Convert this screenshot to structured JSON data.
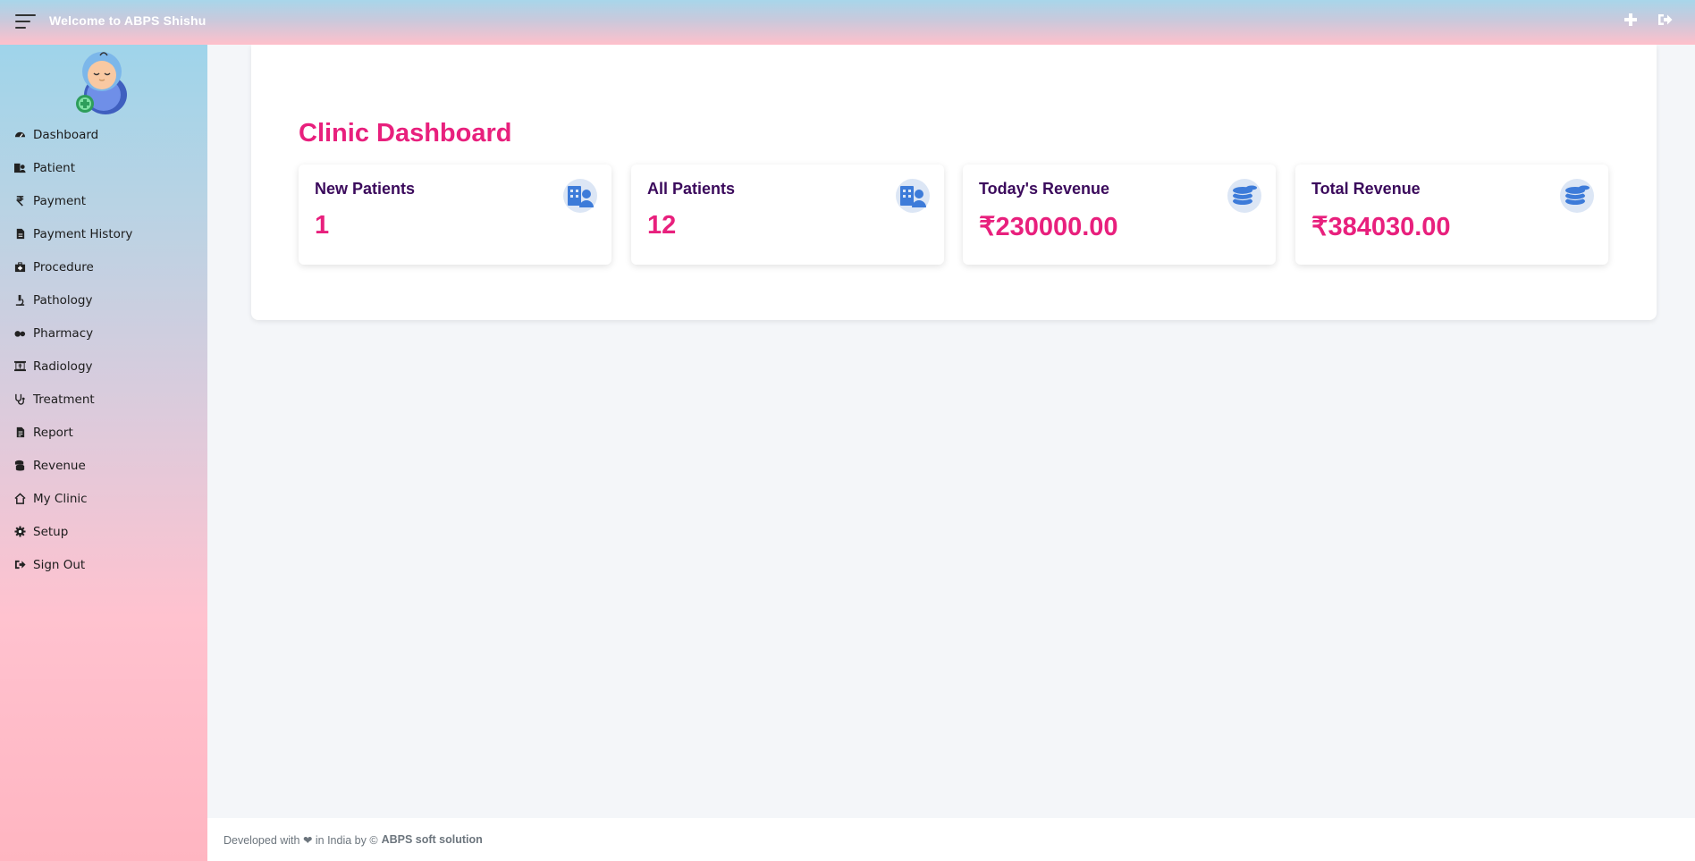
{
  "header": {
    "title": "Welcome to ABPS Shishu",
    "menu_icon": "hamburger-icon",
    "actions": [
      {
        "name": "add",
        "icon": "plus-icon"
      },
      {
        "name": "logout",
        "icon": "sign-out-icon"
      }
    ]
  },
  "sidebar": {
    "logo": "baby-logo",
    "items": [
      {
        "label": "Dashboard",
        "icon": "dashboard-icon"
      },
      {
        "label": "Patient",
        "icon": "hospital-user-icon"
      },
      {
        "label": "Payment",
        "icon": "rupee-icon"
      },
      {
        "label": "Payment History",
        "icon": "file-icon"
      },
      {
        "label": "Procedure",
        "icon": "medkit-icon"
      },
      {
        "label": "Pathology",
        "icon": "microscope-icon"
      },
      {
        "label": "Pharmacy",
        "icon": "pills-icon"
      },
      {
        "label": "Radiology",
        "icon": "xray-icon"
      },
      {
        "label": "Treatment",
        "icon": "stethoscope-icon"
      },
      {
        "label": "Report",
        "icon": "file-text-icon"
      },
      {
        "label": "Revenue",
        "icon": "coins-icon"
      },
      {
        "label": "My Clinic",
        "icon": "home-icon"
      },
      {
        "label": "Setup",
        "icon": "gear-icon"
      },
      {
        "label": "Sign Out",
        "icon": "sign-out-icon"
      }
    ]
  },
  "main": {
    "title": "Clinic Dashboard",
    "cards": [
      {
        "label": "New Patients",
        "value": "1",
        "icon": "hospital-user-icon"
      },
      {
        "label": "All Patients",
        "value": "12",
        "icon": "hospital-user-icon"
      },
      {
        "label": "Today's Revenue",
        "value": "₹230000.00",
        "icon": "coins-icon"
      },
      {
        "label": "Total Revenue",
        "value": "₹384030.00",
        "icon": "coins-icon"
      }
    ]
  },
  "footer": {
    "text": "Developed with ❤ in India by ©",
    "company": "ABPS soft solution"
  },
  "colors": {
    "accent": "#e8207d",
    "label": "#3b0a5c",
    "icon": "#3d7bd9"
  }
}
